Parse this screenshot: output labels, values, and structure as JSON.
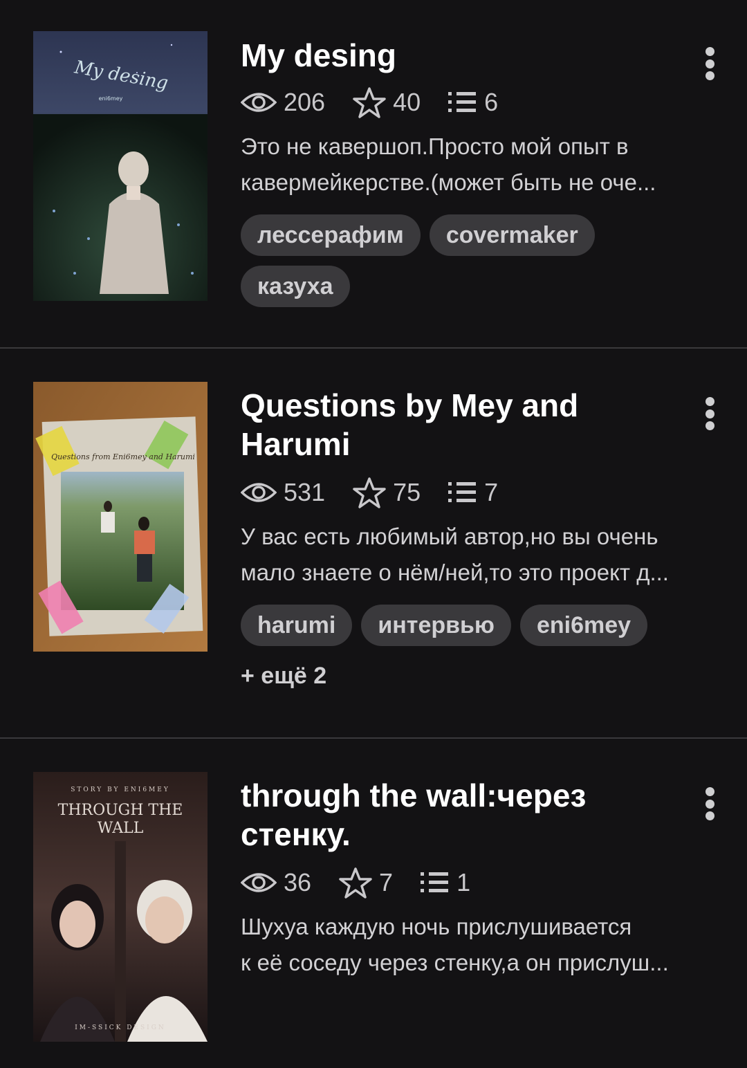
{
  "stories": [
    {
      "title": "My desing",
      "cover_text": [
        "My desing",
        "eni6mey"
      ],
      "views": "206",
      "votes": "40",
      "parts": "6",
      "description": [
        "Это не кавершоп.Просто мой опыт в",
        "кавермейкерстве.(может быть не оче..."
      ],
      "tags": [
        "лессерафим",
        "covermaker",
        "казуха"
      ]
    },
    {
      "title": "Questions by Mey and Harumi",
      "cover_text": [
        "Questions from Eni6mey and Harumi"
      ],
      "views": "531",
      "votes": "75",
      "parts": "7",
      "description": [
        "У вас есть любимый автор,но вы очень",
        "мало знаете о нём/ней,то это проект д..."
      ],
      "tags": [
        "harumi",
        "интервью",
        "eni6mey"
      ],
      "more_tags": "+ ещё 2"
    },
    {
      "title": "through the wall:через стенку.",
      "cover_text": [
        "STORY BY ENI6MEY",
        "THROUGH THE",
        "WALL",
        "IM-SSICK DESIGN"
      ],
      "views": "36",
      "votes": "7",
      "parts": "1",
      "description": [
        "Шухуа каждую ночь прислушивается",
        "к её соседу через стенку,а он прислуш..."
      ]
    }
  ],
  "icons": {
    "views": "eye-icon",
    "votes": "star-icon",
    "parts": "list-icon",
    "menu": "more-vertical-icon"
  },
  "colors": {
    "background": "#131214",
    "tag_background": "#3a393c",
    "text_primary": "#ffffff",
    "text_secondary": "#c9c8cb"
  }
}
